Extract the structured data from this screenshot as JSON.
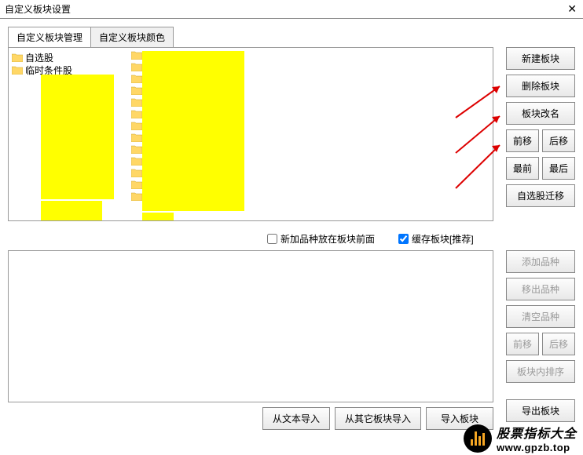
{
  "window": {
    "title": "自定义板块设置"
  },
  "tabs": {
    "manage": "自定义板块管理",
    "color": "自定义板块颜色"
  },
  "folders": {
    "item1": "自选股",
    "item2": "临时条件股"
  },
  "buttons": {
    "new_block": "新建板块",
    "delete_block": "删除板块",
    "rename_block": "板块改名",
    "move_fwd": "前移",
    "move_back": "后移",
    "move_first": "最前",
    "move_last": "最后",
    "migrate": "自选股迁移",
    "add_item": "添加品种",
    "remove_item": "移出品种",
    "clear_items": "清空品种",
    "sort_inner": "板块内排序",
    "import_text": "从文本导入",
    "import_other": "从其它板块导入",
    "import_block": "导入板块",
    "export_block": "导出板块"
  },
  "checkboxes": {
    "add_front": "新加品种放在板块前面",
    "cache": "缓存板块[推荐]"
  },
  "footer": {
    "brand": "股票指标大全",
    "url": "www.gpzb.top"
  }
}
